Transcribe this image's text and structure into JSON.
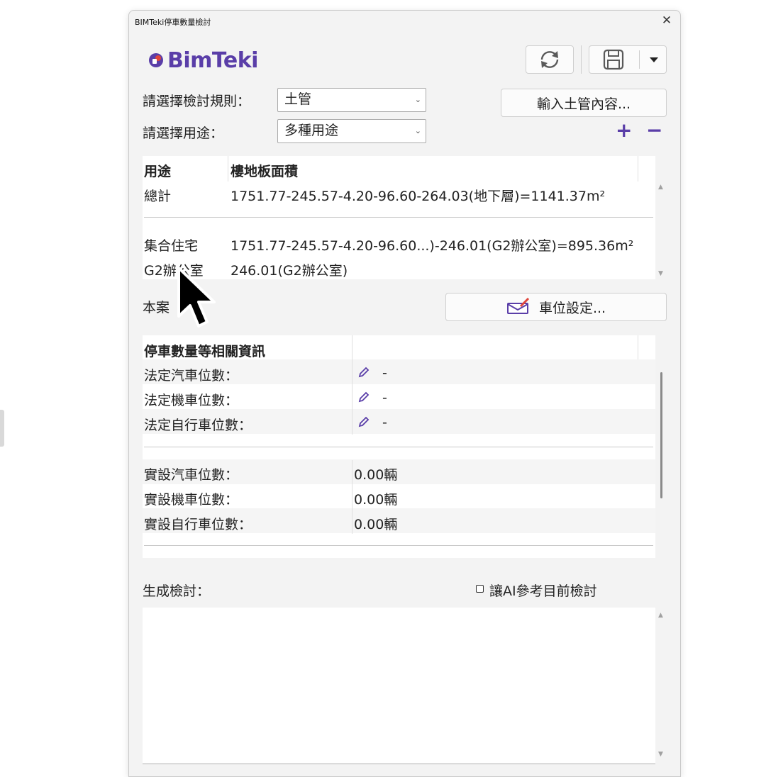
{
  "window": {
    "title": "BIMTeki停車數量檢討",
    "close_icon": "close-icon"
  },
  "logo": {
    "text": "BimTeki",
    "brand_color": "#5a3ea8",
    "accent_color": "#e0463c"
  },
  "toolbar": {
    "refresh_icon": "refresh-icon",
    "save_icon": "save-icon",
    "dropdown_icon": "caret-down-icon"
  },
  "form": {
    "rule_label": "請選擇檢討規則：",
    "rule_value": "土管",
    "use_label": "請選擇用途：",
    "use_value": "多種用途",
    "input_button": "輸入土管內容...",
    "plus": "+",
    "minus": "−"
  },
  "area_table": {
    "headers": [
      "用途",
      "樓地板面積"
    ],
    "rows": [
      {
        "use": "總計",
        "area": "1751.77-245.57-4.20-96.60-264.03(地下層)=1141.37m²"
      },
      {
        "use": "集合住宅",
        "area": "1751.77-245.57-4.20-96.60...)-246.01(G2辦公室)=895.36m²"
      },
      {
        "use": "G2辦公室",
        "area": "246.01(G2辦公室)"
      }
    ]
  },
  "case": {
    "label": "本案",
    "parking_button": "車位設定..."
  },
  "parking_table": {
    "header": "停車數量等相關資訊",
    "legal": [
      {
        "label": "法定汽車位數：",
        "value": "-"
      },
      {
        "label": "法定機車位數：",
        "value": "-"
      },
      {
        "label": "法定自行車位數：",
        "value": "-"
      }
    ],
    "actual": [
      {
        "label": "實設汽車位數：",
        "value": "0.00輛"
      },
      {
        "label": "實設機車位數：",
        "value": "0.00輛"
      },
      {
        "label": "實設自行車位數：",
        "value": "0.00輛"
      }
    ]
  },
  "review": {
    "label": "生成檢討：",
    "ai_checkbox_label": "讓AI參考目前檢討",
    "ai_checked": false,
    "text": ""
  }
}
